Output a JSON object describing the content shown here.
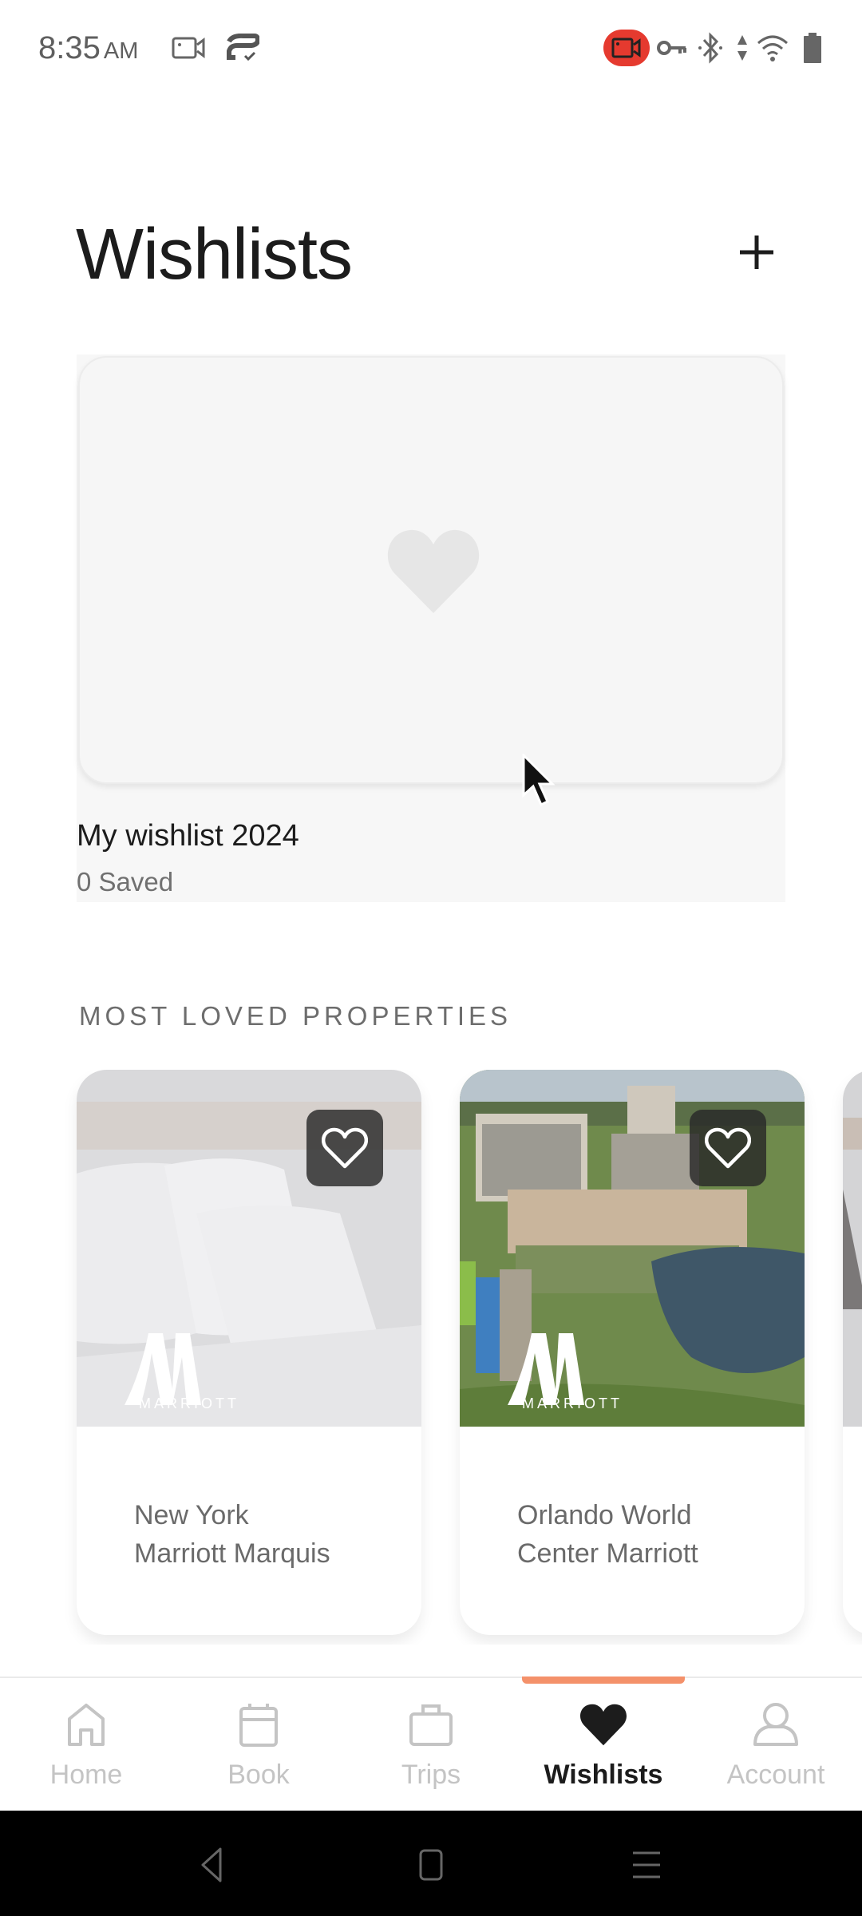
{
  "status_bar": {
    "time": "8:35",
    "ampm": "AM",
    "icons": [
      "screen-record-icon",
      "sync-check-icon",
      "recording-active-icon",
      "vpn-key-icon",
      "bluetooth-icon",
      "data-arrows-icon",
      "wifi-icon",
      "battery-icon"
    ],
    "recording_color": "#e53a2f"
  },
  "header": {
    "title": "Wishlists",
    "add_button_icon": "plus-icon"
  },
  "wishlists": [
    {
      "name": "My wishlist 2024",
      "count_label": "0 Saved",
      "thumbnail_icon": "heart-icon"
    }
  ],
  "section": {
    "title": "MOST LOVED PROPERTIES"
  },
  "properties": [
    {
      "name_line1": "New York",
      "name_line2": "Marriott Marquis",
      "brand": "MARRIOTT",
      "favorite": false,
      "image": "bedroom-pillows"
    },
    {
      "name_line1": "Orlando World",
      "name_line2": "Center Marriott",
      "brand": "MARRIOTT",
      "favorite": false,
      "image": "resort-aerial"
    },
    {
      "name_line1": "",
      "name_line2": "",
      "brand": "",
      "favorite": false,
      "image": "partial-card"
    }
  ],
  "bottom_nav": {
    "accent_color": "#f4916a",
    "items": [
      {
        "label": "Home",
        "icon": "home-icon",
        "active": false
      },
      {
        "label": "Book",
        "icon": "calendar-icon",
        "active": false
      },
      {
        "label": "Trips",
        "icon": "suitcase-icon",
        "active": false
      },
      {
        "label": "Wishlists",
        "icon": "heart-icon",
        "active": true
      },
      {
        "label": "Account",
        "icon": "person-icon",
        "active": false
      }
    ]
  },
  "system_nav": {
    "buttons": [
      "back",
      "home",
      "recents"
    ]
  }
}
